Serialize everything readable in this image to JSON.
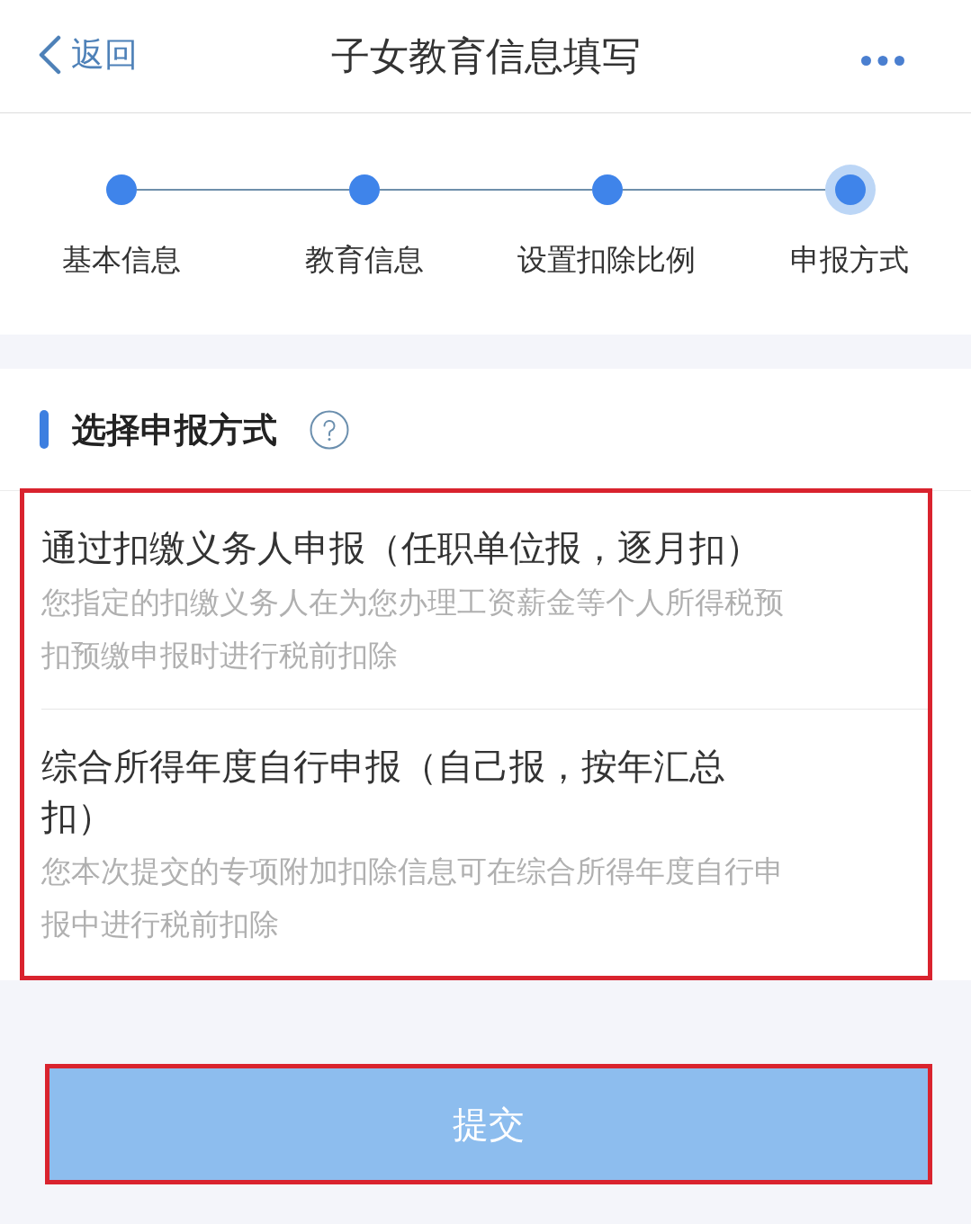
{
  "nav": {
    "back_label": "返回",
    "title": "子女教育信息填写"
  },
  "steps": [
    {
      "label": "基本信息",
      "selected": false
    },
    {
      "label": "教育信息",
      "selected": false
    },
    {
      "label": "设置扣除比例",
      "selected": false
    },
    {
      "label": "申报方式",
      "selected": true
    }
  ],
  "section": {
    "title": "选择申报方式"
  },
  "options": {
    "highlighted": true,
    "items": [
      {
        "title": "通过扣缴义务人申报（任职单位报，逐月扣）",
        "description": "您指定的扣缴义务人在为您办理工资薪金等个人所得税预扣预缴申报时进行税前扣除"
      },
      {
        "title": "综合所得年度自行申报（自己报，按年汇总扣）",
        "description": "您本次提交的专项附加扣除信息可在综合所得年度自行申报中进行税前扣除"
      }
    ]
  },
  "submit_button": {
    "label": "提交",
    "disabled": true,
    "highlighted": true
  }
}
